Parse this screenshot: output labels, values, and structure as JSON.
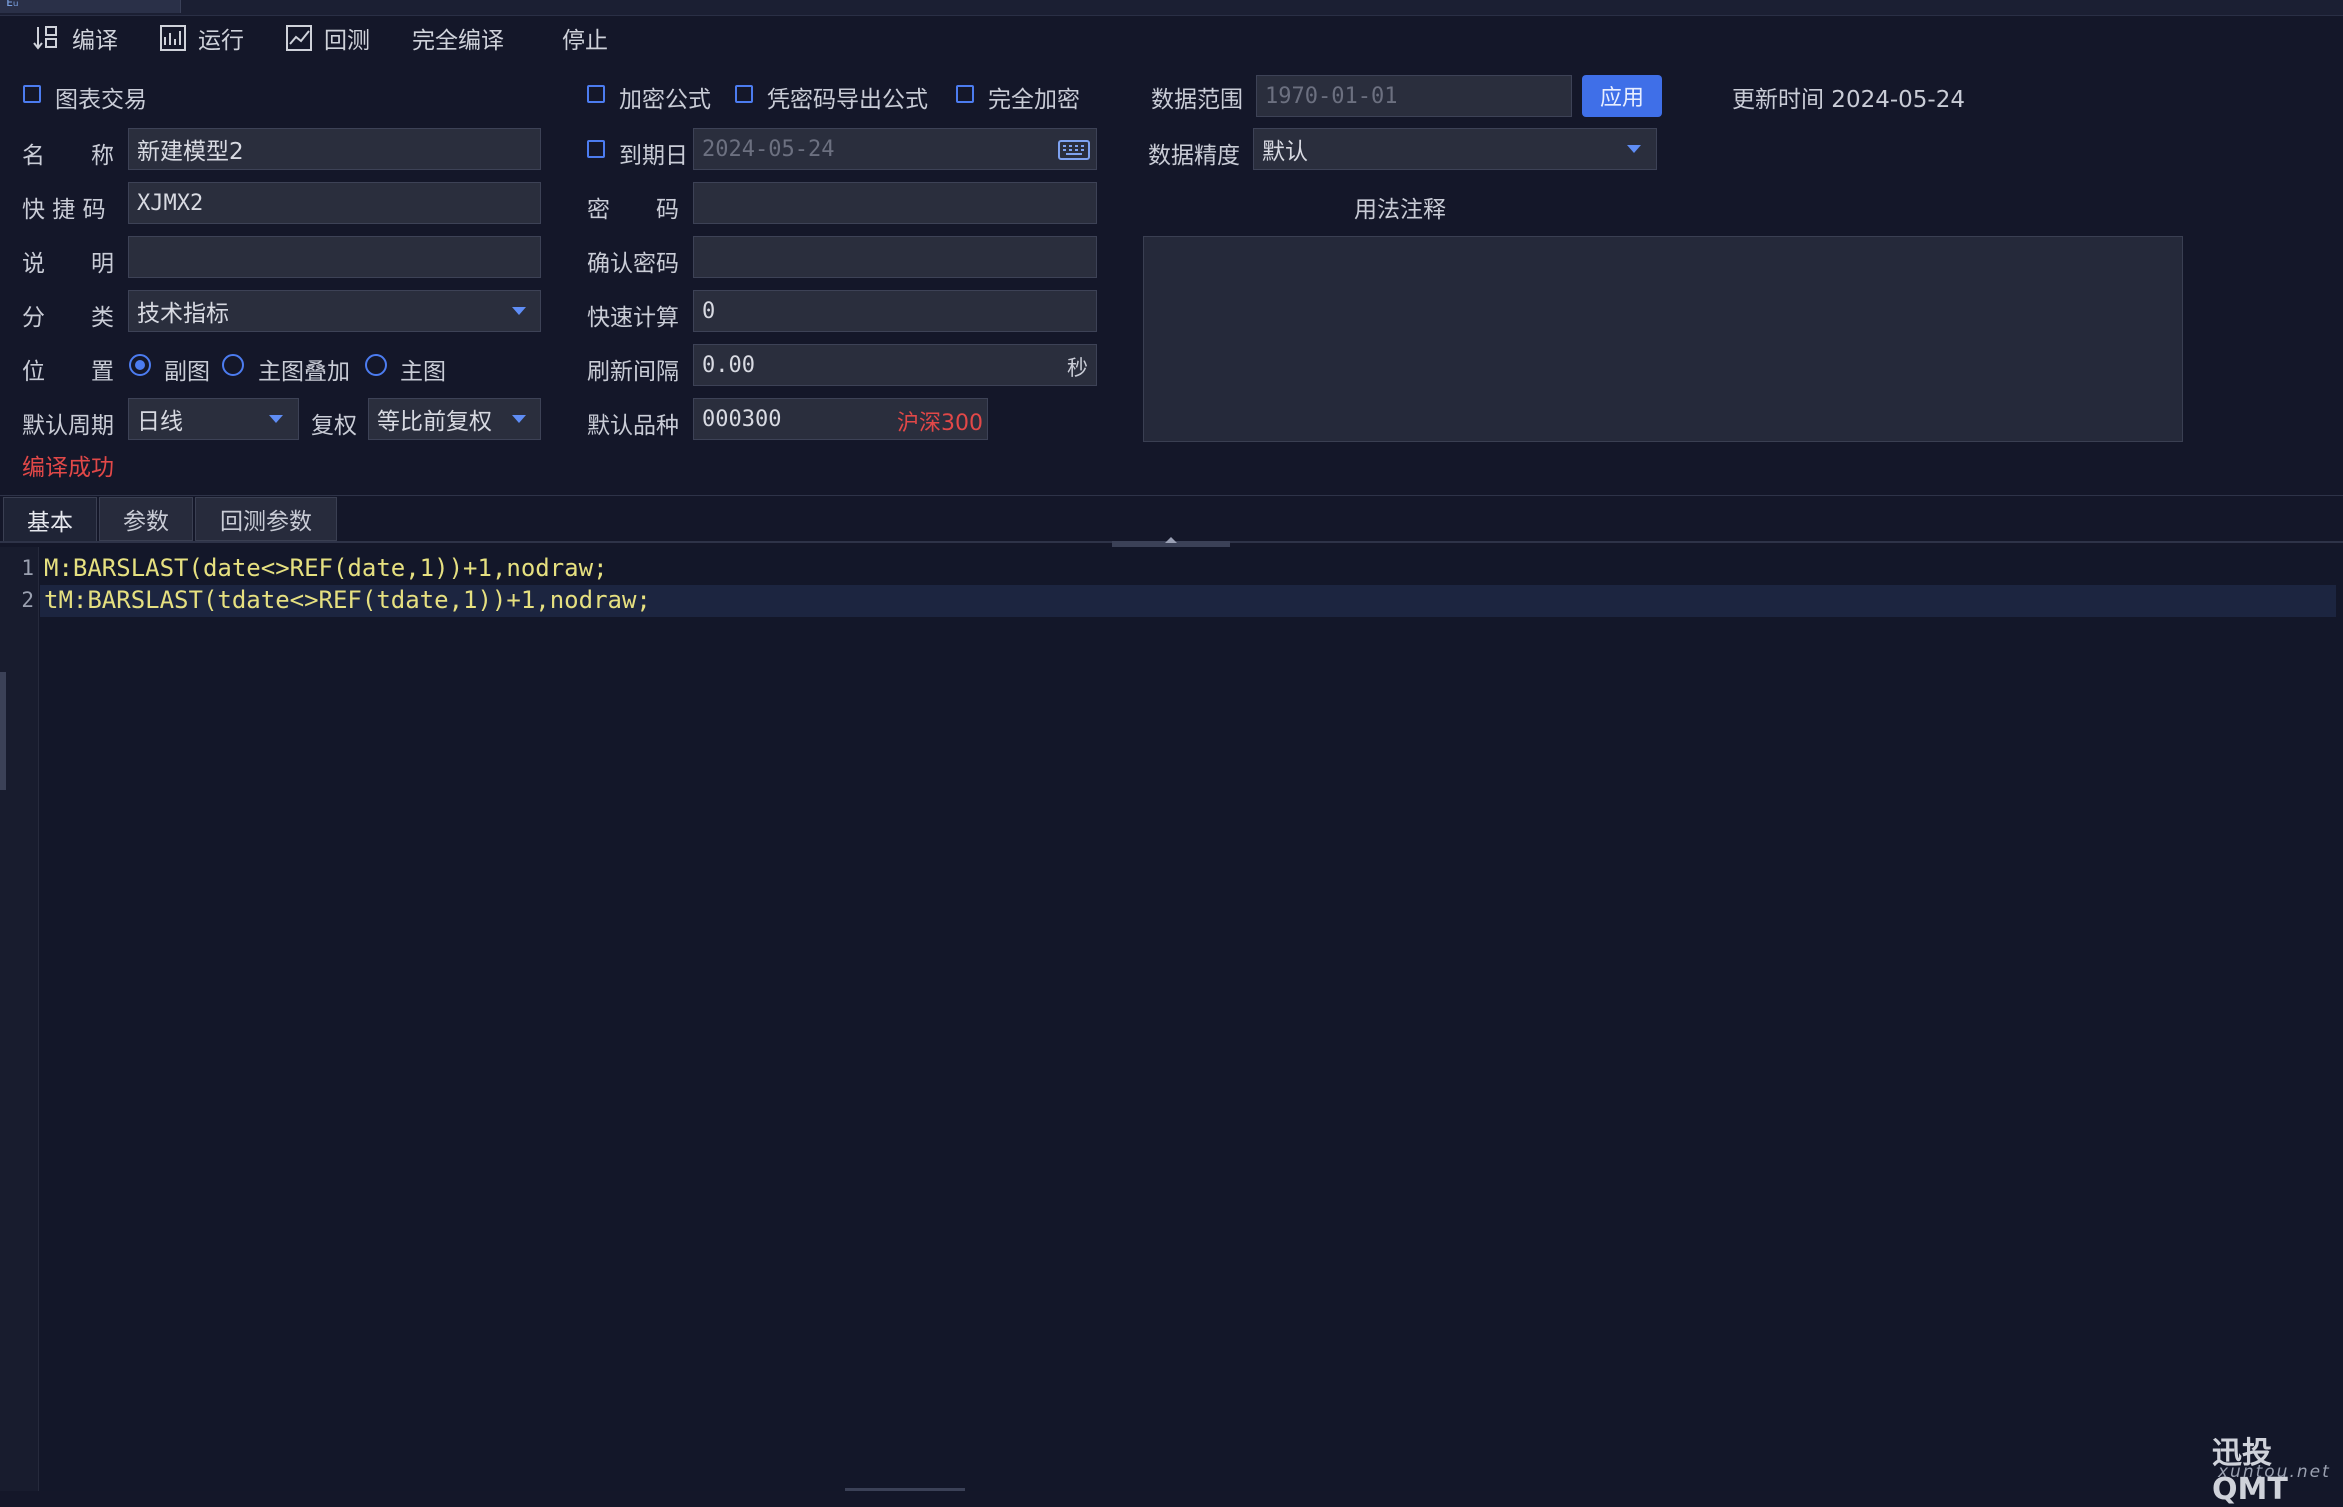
{
  "toolbar": {
    "compile": "编译",
    "run": "运行",
    "backtest": "回测",
    "full_compile": "完全编译",
    "stop": "停止"
  },
  "left": {
    "chart_trade": "图表交易",
    "name_label": "名　　称",
    "name_value": "新建模型2",
    "shortcut_label": "快 捷 码",
    "shortcut_value": "XJMX2",
    "desc_label": "说　　明",
    "desc_value": "",
    "category_label": "分　　类",
    "category_value": "技术指标",
    "position_label": "位　　置",
    "position_options": [
      "副图",
      "主图叠加",
      "主图"
    ],
    "position_selected": "副图",
    "period_label": "默认周期",
    "period_value": "日线",
    "adjust_label": "复权",
    "adjust_value": "等比前复权",
    "compile_status": "编译成功"
  },
  "middle": {
    "encrypt_formula": "加密公式",
    "export_with_pwd": "凭密码导出公式",
    "full_encrypt": "完全加密",
    "expire_label": "到期日",
    "expire_value": "2024-05-24",
    "pwd_label": "密　　码",
    "pwd_value": "",
    "confirm_pwd_label": "确认密码",
    "confirm_pwd_value": "",
    "quick_calc_label": "快速计算",
    "quick_calc_value": "0",
    "refresh_label": "刷新间隔",
    "refresh_value": "0.00",
    "refresh_unit": "秒",
    "symbol_label": "默认品种",
    "symbol_value": "000300",
    "symbol_name": "沪深300"
  },
  "right": {
    "data_range_label": "数据范围",
    "data_range_value": "1970-01-01",
    "apply": "应用",
    "update_time": "更新时间 2024-05-24",
    "precision_label": "数据精度",
    "precision_value": "默认",
    "notes_title": "用法注释",
    "notes_value": ""
  },
  "tabs": [
    "基本",
    "参数",
    "回测参数"
  ],
  "editor": {
    "lines": [
      {
        "num": "1",
        "text": "M:BARSLAST(date<>REF(date,1))+1,nodraw;"
      },
      {
        "num": "2",
        "text": "tM:BARSLAST(tdate<>REF(tdate,1))+1,nodraw;"
      }
    ]
  },
  "watermark": {
    "brand": "迅投QMT",
    "url": "xuntou.net"
  },
  "colors": {
    "accent": "#4c7cf0",
    "error": "#e24848",
    "background": "#141729"
  }
}
